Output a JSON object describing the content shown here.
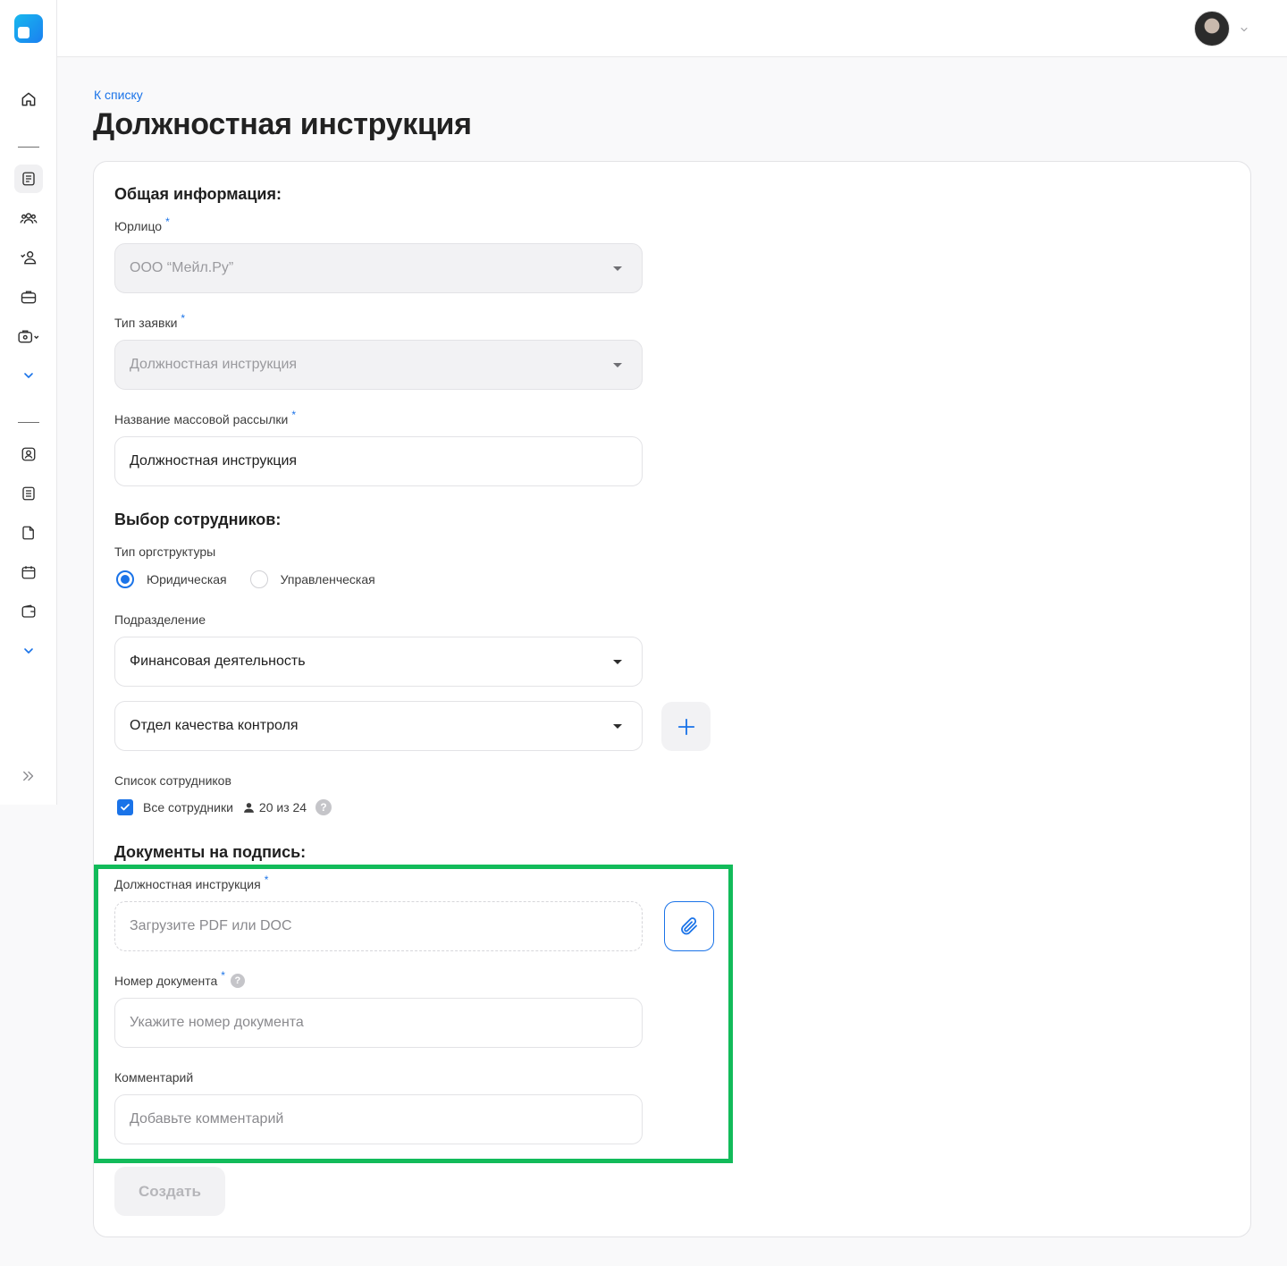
{
  "header": {
    "back_link": "К списку",
    "page_title": "Должностная инструкция"
  },
  "section_general": {
    "title": "Общая информация:",
    "legal_entity": {
      "label": "Юрлицо",
      "required": "*",
      "value": "ООО “Мейл.Ру”"
    },
    "request_type": {
      "label": "Тип заявки",
      "required": "*",
      "value": "Должностная инструкция"
    },
    "mailing_name": {
      "label": "Название массовой рассылки",
      "required": "*",
      "value": "Должностная инструкция"
    }
  },
  "section_employees": {
    "title": "Выбор сотрудников:",
    "org_type_label": "Тип оргструктуры",
    "org_type_options": [
      "Юридическая",
      "Управленческая"
    ],
    "org_type_selected": "Юридическая",
    "department_label": "Подразделение",
    "department_1": "Финансовая деятельность",
    "department_2": "Отдел качества контроля",
    "employee_list_label": "Список сотрудников",
    "all_employees_label": "Все сотрудники",
    "employee_count": "20 из 24",
    "help_glyph": "?"
  },
  "section_documents": {
    "title": "Документы на подпись:",
    "document": {
      "label": "Должностная инструкция",
      "required": "*",
      "placeholder": "Загрузите PDF или DOC"
    },
    "doc_number": {
      "label": "Номер документа",
      "required": "*",
      "placeholder": "Укажите номер документа"
    },
    "comment": {
      "label": "Комментарий",
      "placeholder": "Добавьте комментарий"
    }
  },
  "actions": {
    "create_label": "Создать"
  },
  "colors": {
    "accent": "#1a73e8",
    "highlight": "#12bb5a",
    "disabled_bg": "#f2f2f4"
  },
  "icons": {
    "sidebar": [
      "home-icon",
      "document-list-icon",
      "users-icon",
      "user-check-icon",
      "briefcase-icon",
      "briefcase-settings-icon",
      "chevron-down-icon",
      "user-card-icon",
      "document-icon",
      "file-icon",
      "calendar-icon",
      "wallet-icon",
      "chevron-down-icon",
      "expand-icon"
    ]
  }
}
